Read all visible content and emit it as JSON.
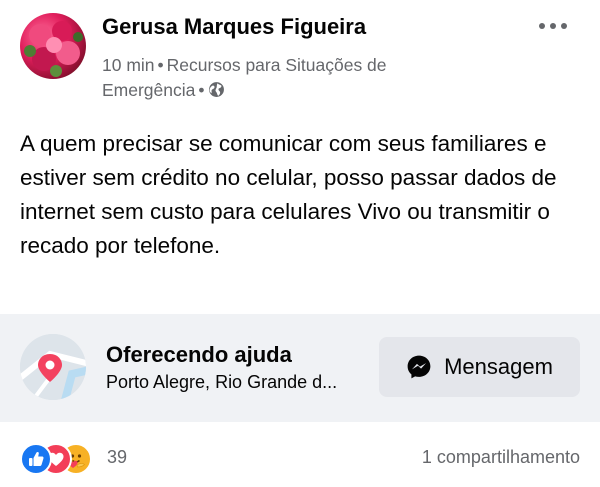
{
  "post": {
    "author": "Gerusa Marques Figueira",
    "time": "10 min",
    "group": "Recursos para Situações de Emergência",
    "separator": "•",
    "audience_icon": "globe-icon",
    "more_icon": "more-options-icon",
    "text": "A quem precisar se comunicar com seus familiares e estiver sem crédito no celular, posso passar dados de internet sem custo para celulares Vivo ou transmitir o recado por telefone."
  },
  "card": {
    "icon": "map-pin-icon",
    "title": "Oferecendo ajuda",
    "location": "Porto Alegre, Rio Grande d...",
    "button_label": "Mensagem",
    "button_icon": "messenger-icon"
  },
  "footer": {
    "reactions": [
      "like",
      "love",
      "care"
    ],
    "reaction_count": "39",
    "shares": "1 compartilhamento"
  },
  "colors": {
    "secondary_text": "#65676b",
    "card_background": "#f0f2f5",
    "button_background": "#e4e6eb",
    "like": "#1877f2",
    "love": "#f33e58",
    "care": "#f7b125"
  }
}
